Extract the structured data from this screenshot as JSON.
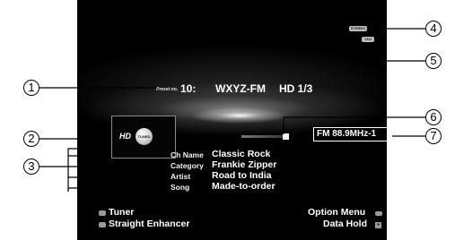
{
  "callouts": [
    "1",
    "2",
    "3",
    "4",
    "5",
    "6",
    "7"
  ],
  "screen": {
    "preset_label": "Preset no.",
    "preset_number": "10:",
    "station": "WXYZ-FM",
    "hd_channel": "HD 1/3",
    "badges": {
      "stereo": "STEREO",
      "tag": "TAG"
    },
    "hd_logo": "HD",
    "tuned": "TUNED",
    "frequency": "FM 88.9MHz-1",
    "info": {
      "labels": [
        "Ch Name",
        "Category",
        "Artist",
        "Song"
      ],
      "values": [
        "Classic Rock",
        "Frankie Zipper",
        "Road to India",
        "Made-to-order"
      ]
    },
    "footer": {
      "left": [
        "Tuner",
        "Straight Enhancer"
      ],
      "right": [
        "Option Menu",
        "Data Hold"
      ],
      "right_icon_2": "+"
    }
  },
  "colors": {
    "screen_background": "#000000",
    "text": "#ffffff",
    "callout_line": "#000000"
  },
  "icon_names": [
    "hd-radio-icon",
    "tuned-indicator-icon",
    "signal-strength-icon",
    "tuner-button-icon",
    "dsp-button-icon",
    "option-button-icon",
    "plus-button-icon"
  ]
}
